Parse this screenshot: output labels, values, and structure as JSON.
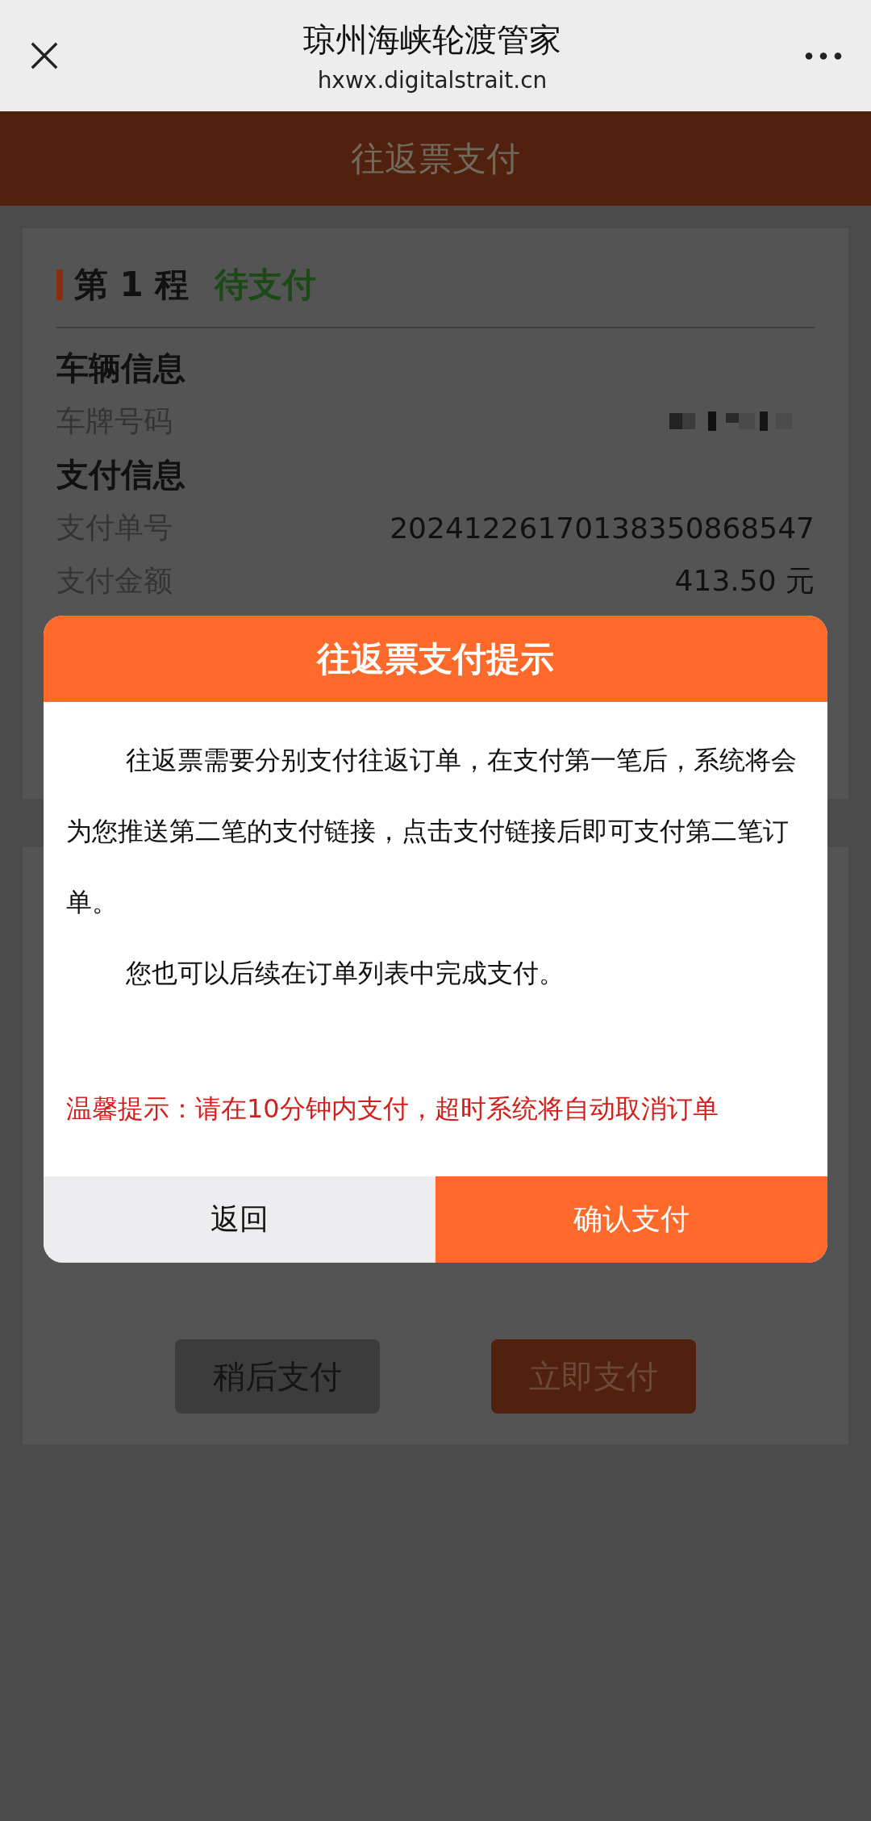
{
  "browser_bar": {
    "title": "琼州海峡轮渡管家",
    "url": "hxwx.digitalstrait.cn"
  },
  "page_header": {
    "title": "往返票支付"
  },
  "trip_card": {
    "heading": "第 1 程",
    "status": "待支付",
    "sections": [
      {
        "title": "车辆信息",
        "rows": [
          {
            "label": "车牌号码",
            "kind": "redacted"
          }
        ]
      },
      {
        "title": "支付信息",
        "rows": [
          {
            "label": "支付单号",
            "value": "20241226170138350868547",
            "kind": "text"
          },
          {
            "label": "支付金额",
            "value": "413.50 元",
            "kind": "text"
          }
        ]
      }
    ]
  },
  "actions": [
    {
      "label": "稍后支付",
      "kind": "secondary"
    },
    {
      "label": "立即支付",
      "kind": "primary"
    }
  ],
  "dialog": {
    "title": "往返票支付提示",
    "paragraphs": [
      {
        "text": "往返票需要分别支付往返订单，在支付第一笔后，系统将会为您推送第二笔的支付链接，点击支付链接后即可支付第二笔订单。",
        "kind": "body"
      },
      {
        "text": "您也可以后续在订单列表中完成支付。",
        "kind": "body"
      },
      {
        "text": "温馨提示：请在10分钟内支付，超时系统将自动取消订单",
        "kind": "warning"
      }
    ],
    "buttons": [
      {
        "label": "返回",
        "kind": "secondary"
      },
      {
        "label": "确认支付",
        "kind": "primary"
      }
    ]
  }
}
